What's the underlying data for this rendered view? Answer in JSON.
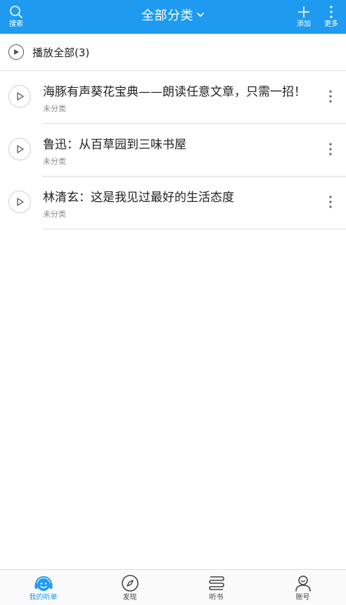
{
  "header": {
    "search_label": "搜索",
    "title": "全部分类",
    "add_label": "添加",
    "more_label": "更多",
    "bg_color": "#1e9bf0"
  },
  "play_all": {
    "label": "播放全部(3)"
  },
  "items": [
    {
      "title": "海豚有声葵花宝典——朗读任意文章，只需一招！",
      "category": "未分类"
    },
    {
      "title": "鲁迅：从百草园到三味书屋",
      "category": "未分类"
    },
    {
      "title": "林清玄：这是我见过最好的生活态度",
      "category": "未分类"
    }
  ],
  "tabbar": {
    "tabs": [
      {
        "label": "我的听单",
        "icon": "smiley-headphone-icon",
        "active": true
      },
      {
        "label": "发现",
        "icon": "compass-icon",
        "active": false
      },
      {
        "label": "听书",
        "icon": "book-icon",
        "active": false
      },
      {
        "label": "账号",
        "icon": "user-icon",
        "active": false
      }
    ]
  }
}
